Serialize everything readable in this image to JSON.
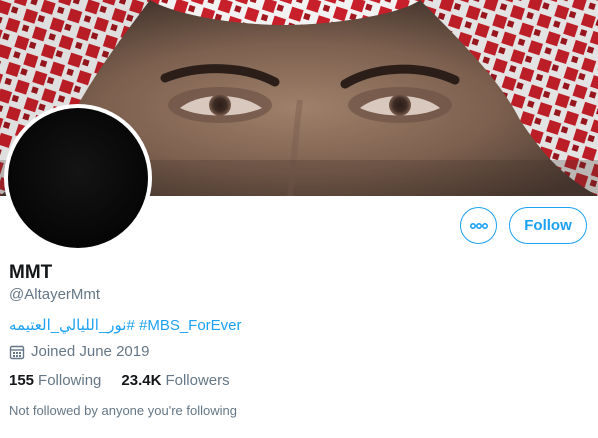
{
  "profile": {
    "name": "MMT",
    "handle": "@AltayerMmt",
    "bio_hashtags": [
      "#نور_الليالي_العتيمه",
      "#MBS_ForEver"
    ],
    "joined": "Joined June 2019",
    "following_count": "155",
    "following_label": "Following",
    "followers_count": "23.4K",
    "followers_label": "Followers",
    "not_followed_text": "Not followed by anyone you're following"
  },
  "actions": {
    "follow_label": "Follow",
    "more_icon": "more-horizontal-icon"
  },
  "colors": {
    "accent": "#1da1f2",
    "secondary_text": "#657786",
    "primary_text": "#14171a"
  }
}
